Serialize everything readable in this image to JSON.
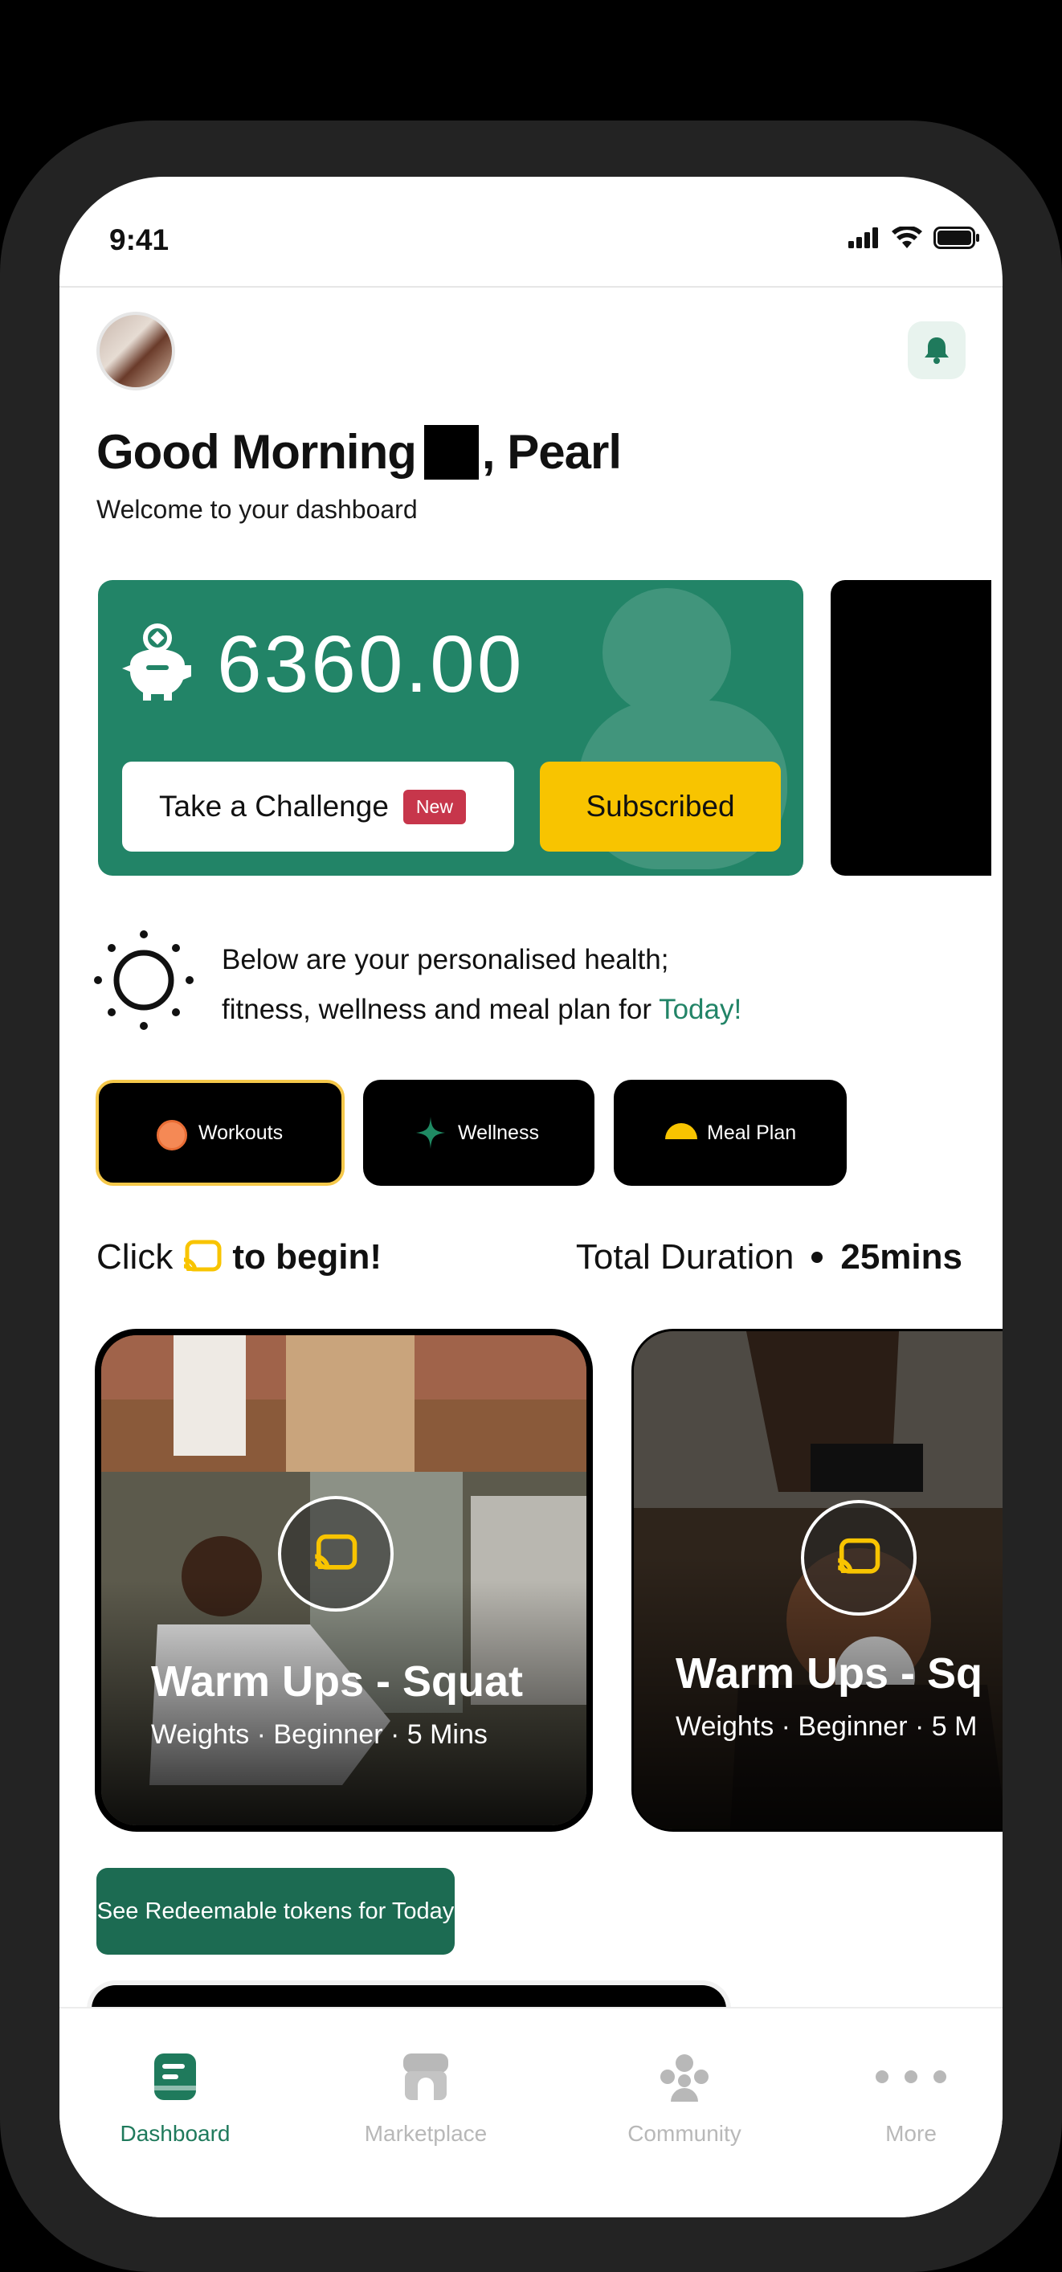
{
  "status_bar": {
    "time": "9:41"
  },
  "header": {
    "greeting_prefix": "Good Morning",
    "greeting_name": ", Pearl",
    "subtitle": "Welcome to your  dashboard"
  },
  "balance_card": {
    "amount": "6360.00",
    "challenge_label": "Take a Challenge",
    "challenge_badge": "New",
    "subscribed_label": "Subscribed",
    "colors": {
      "card": "#228467",
      "badge": "#c7364b",
      "subscribed": "#f8c400"
    }
  },
  "daily_message": {
    "line1": "Below are your personalised  health;",
    "line2_prefix": "fitness, wellness and meal plan for ",
    "line2_highlight": "Today!"
  },
  "tabs": [
    {
      "label": "Workouts",
      "icon": "orange-dot-icon",
      "selected": true
    },
    {
      "label": "Wellness",
      "icon": "sparkle-icon",
      "selected": false
    },
    {
      "label": "Meal Plan",
      "icon": "half-circle-icon",
      "selected": false
    }
  ],
  "begin_row": {
    "click_text": "Click",
    "begin_text": "to begin!",
    "duration_label": "Total Duration",
    "duration_value": "25mins"
  },
  "workout_cards": [
    {
      "title": "Warm Ups - Squat",
      "meta": "Weights · Beginner · 5 Mins"
    },
    {
      "title": "Warm Ups - Sq",
      "meta": "Weights · Beginner · 5 M"
    }
  ],
  "redeem_button": "See Redeemable tokens for Today",
  "bottom_nav": [
    {
      "label": "Dashboard",
      "icon": "dashboard-icon",
      "active": true
    },
    {
      "label": "Marketplace",
      "icon": "store-icon",
      "active": false
    },
    {
      "label": "Community",
      "icon": "community-icon",
      "active": false
    },
    {
      "label": "More",
      "icon": "more-dots-icon",
      "active": false
    }
  ]
}
